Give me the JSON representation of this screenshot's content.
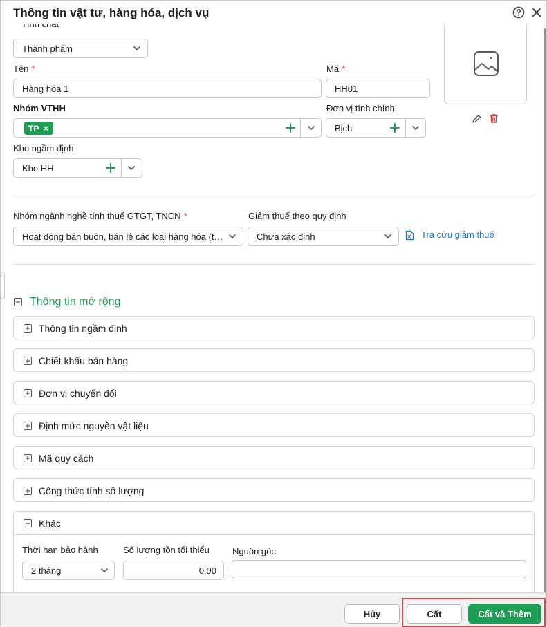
{
  "dialog": {
    "title": "Thông tin vật tư, hàng hóa, dịch vụ",
    "help_icon": "help-circle-icon",
    "close_icon": "close-icon"
  },
  "form": {
    "tinh_chat": {
      "label": "Tính chất",
      "value": "Thành phẩm"
    },
    "ten": {
      "label": "Tên",
      "required": "*",
      "value": "Hàng hóa 1"
    },
    "ma": {
      "label": "Mã",
      "required": "*",
      "value": "HH01"
    },
    "nhom_vthh": {
      "label": "Nhóm VTHH",
      "tag": "TP",
      "tag_remove": "✕"
    },
    "don_vi_tinh": {
      "label": "Đơn vị tính chính",
      "value": "Bịch"
    },
    "kho": {
      "label": "Kho ngầm định",
      "value": "Kho HH"
    },
    "nhom_nganh": {
      "label": "Nhóm ngành nghề tính thuế GTGT, TNCN",
      "required": "*",
      "value": "Hoạt động bán buôn, bán lẻ các loại hàng hóa (trừ giá trị hàng hóa đại lý bán đúng giá hưởng hoa hồng)"
    },
    "giam_thue": {
      "label": "Giảm thuế theo quy định",
      "value": "Chưa xác định"
    },
    "tra_cuu_link": "Tra cứu giảm thuế"
  },
  "extended": {
    "title": "Thông tin mở rộng",
    "sections": [
      {
        "label": "Thông tin ngầm định"
      },
      {
        "label": "Chiết khấu bán hàng"
      },
      {
        "label": "Đơn vị chuyển đổi"
      },
      {
        "label": "Định mức nguyên vật liệu"
      },
      {
        "label": "Mã quy cách"
      },
      {
        "label": "Công thức tính số lượng"
      }
    ],
    "khac": {
      "label": "Khác",
      "thoi_han": {
        "label": "Thời hạn bảo hành",
        "value": "2 tháng"
      },
      "so_luong_ton": {
        "label": "Số lượng tồn tối thiểu",
        "value": "0,00"
      },
      "nguon_goc": {
        "label": "Nguồn gốc",
        "value": ""
      }
    }
  },
  "footer": {
    "cancel_label": "Hủy",
    "save_label": "Cất",
    "save_add_label": "Cất và Thêm"
  },
  "colors": {
    "accent": "#1f9d55",
    "link": "#1a78c2",
    "required": "#e53935",
    "highlight_frame": "#d84a4a"
  }
}
